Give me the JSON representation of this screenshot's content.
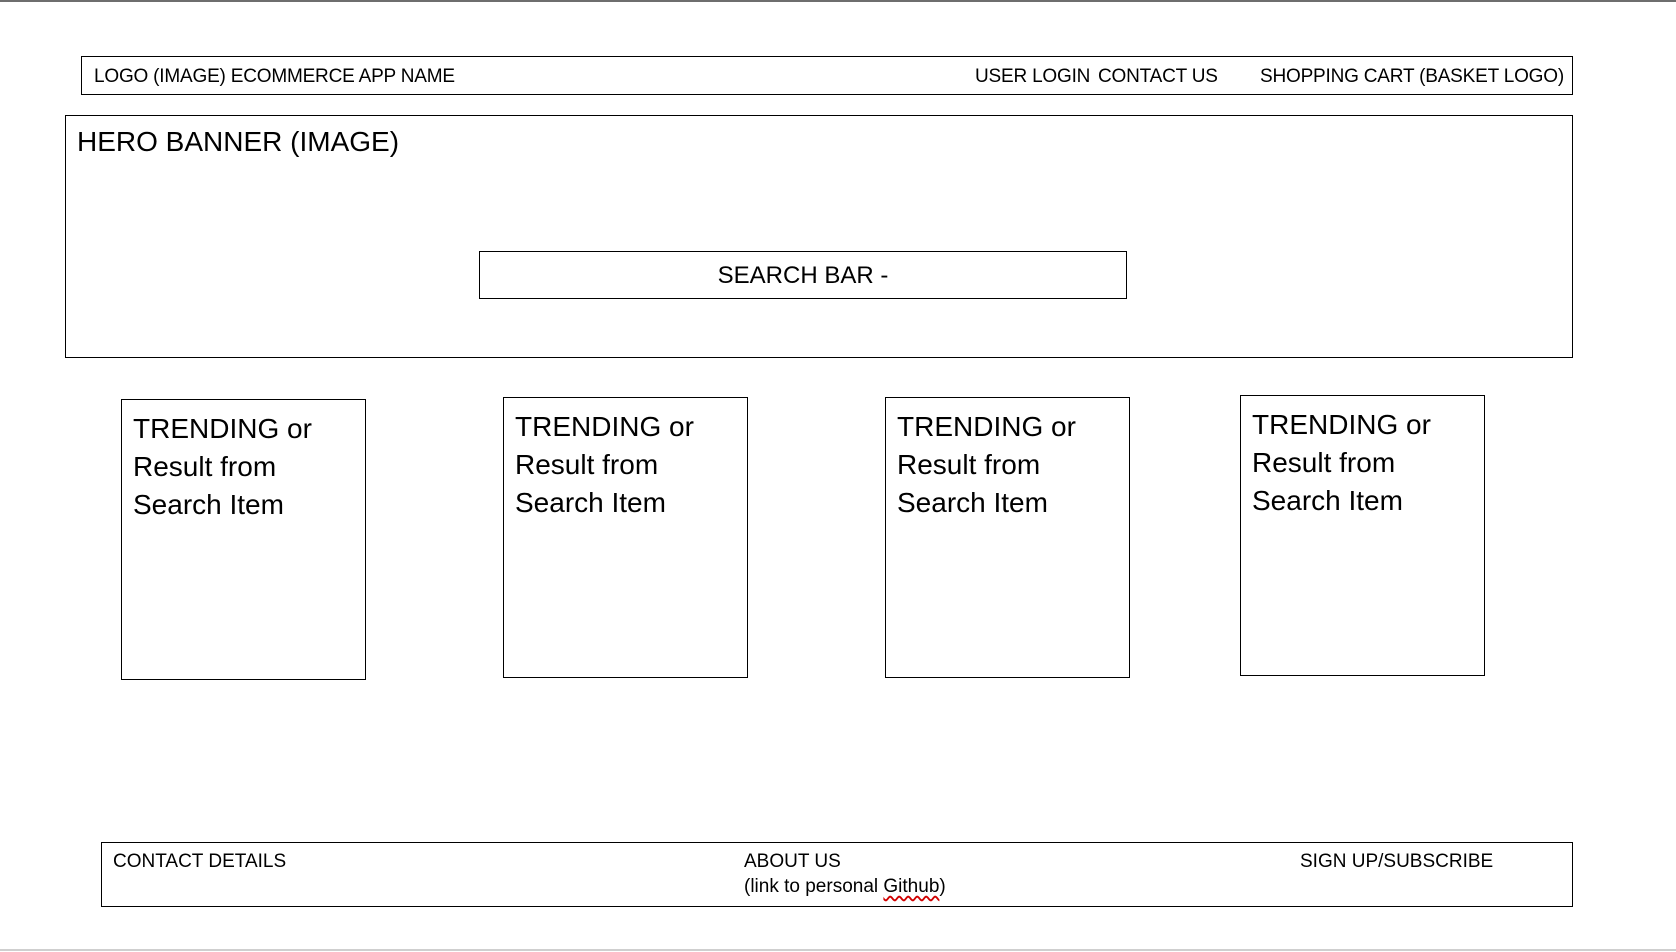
{
  "header": {
    "logo_app_name": "LOGO (IMAGE) ECOMMERCE APP NAME",
    "nav": {
      "user_login": "USER LOGIN",
      "contact_us": "CONTACT US",
      "shopping_cart": "SHOPPING CART (BASKET LOGO)"
    }
  },
  "hero": {
    "title": "HERO BANNER (IMAGE)",
    "search_label": "SEARCH BAR -"
  },
  "cards": [
    {
      "line1": "TRENDING or",
      "line2": "Result from",
      "line3": "Search Item"
    },
    {
      "line1": "TRENDING or",
      "line2": "Result from",
      "line3": "Search Item"
    },
    {
      "line1": "TRENDING or",
      "line2": "Result from",
      "line3": "Search Item"
    },
    {
      "line1": "TRENDING or",
      "line2": "Result from",
      "line3": "Search Item"
    }
  ],
  "footer": {
    "contact_details": "CONTACT DETAILS",
    "about_us": "ABOUT US",
    "about_us_note_prefix": "(link to personal ",
    "about_us_note_link": "Github",
    "about_us_note_suffix": ")",
    "signup": "SIGN UP/SUBSCRIBE"
  }
}
